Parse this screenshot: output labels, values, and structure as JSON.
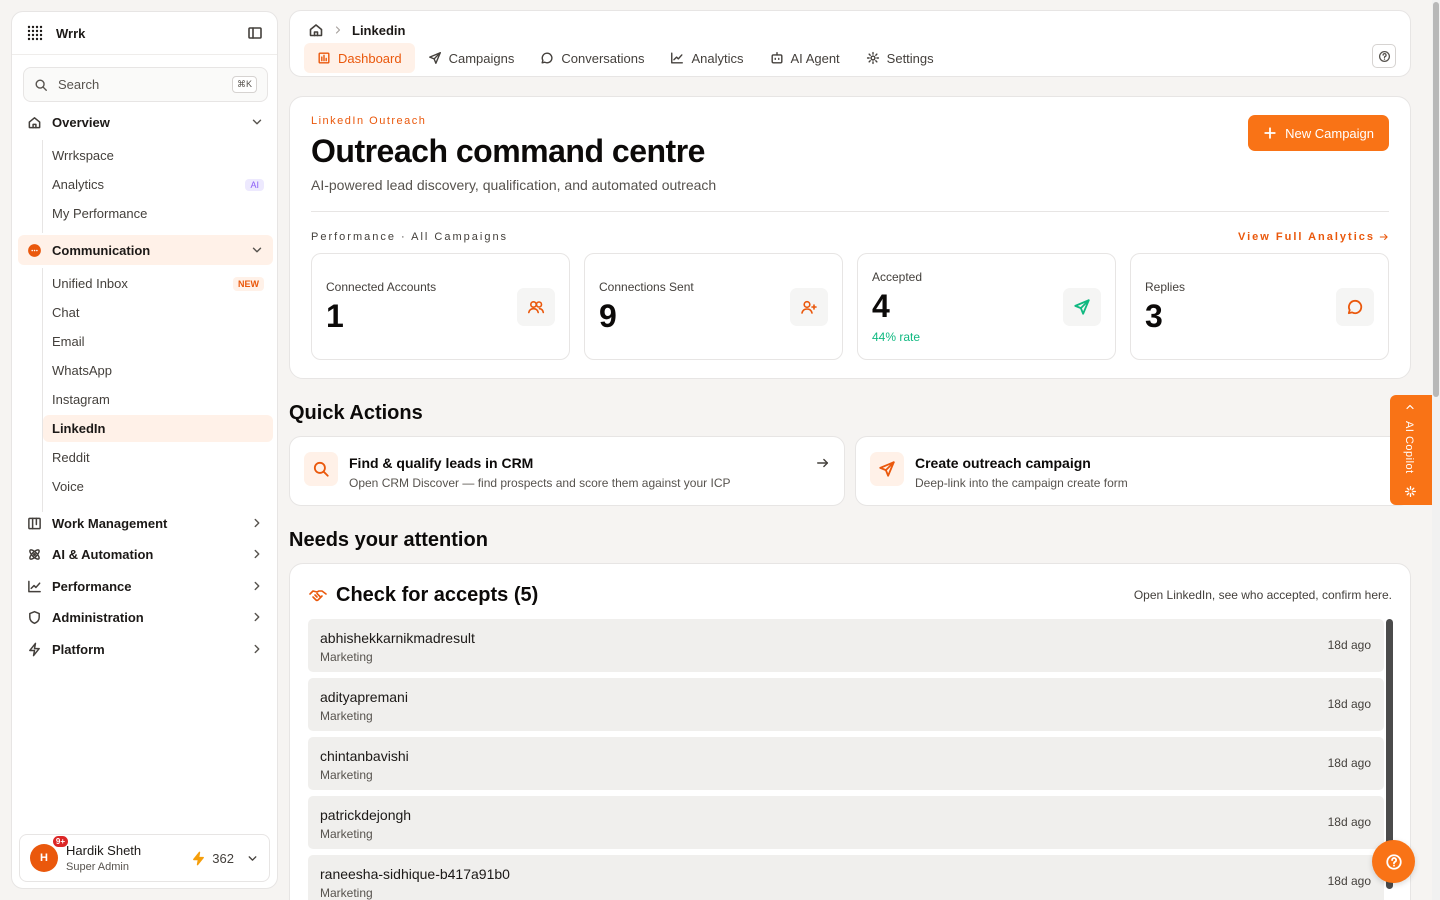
{
  "sidebar": {
    "brand": "Wrrk",
    "search_placeholder": "Search",
    "search_shortcut": "⌘K",
    "sections": {
      "overview": "Overview",
      "communication": "Communication",
      "work_management": "Work Management",
      "ai_automation": "AI & Automation",
      "performance": "Performance",
      "administration": "Administration",
      "platform": "Platform"
    },
    "overview_items": [
      "Wrrkspace",
      "Analytics",
      "My Performance"
    ],
    "analytics_tag": "AI",
    "communication_items": [
      "Unified Inbox",
      "Chat",
      "Email",
      "WhatsApp",
      "Instagram",
      "LinkedIn",
      "Reddit",
      "Voice"
    ],
    "unified_inbox_tag": "NEW",
    "active_item": "LinkedIn",
    "user": {
      "initial": "H",
      "badge": "9+",
      "name": "Hardik Sheth",
      "role": "Super Admin",
      "credits": "362"
    }
  },
  "topbar": {
    "breadcrumb_current": "Linkedin",
    "tabs": [
      "Dashboard",
      "Campaigns",
      "Conversations",
      "Analytics",
      "AI Agent",
      "Settings"
    ],
    "active_tab": "Dashboard"
  },
  "hero": {
    "eyebrow": "LinkedIn Outreach",
    "title": "Outreach command centre",
    "subtitle": "AI-powered lead discovery, qualification, and automated outreach",
    "new_campaign_label": "New Campaign",
    "performance_label": "Performance · All Campaigns",
    "view_analytics_label": "View Full Analytics"
  },
  "stats": [
    {
      "label": "Connected Accounts",
      "value": "1",
      "icon": "users-icon"
    },
    {
      "label": "Connections Sent",
      "value": "9",
      "icon": "user-plus-icon"
    },
    {
      "label": "Accepted",
      "value": "4",
      "rate": "44% rate",
      "icon": "send-icon"
    },
    {
      "label": "Replies",
      "value": "3",
      "icon": "message-icon"
    }
  ],
  "quick_actions": {
    "title": "Quick Actions",
    "items": [
      {
        "title": "Find & qualify leads in CRM",
        "desc": "Open CRM Discover — find prospects and score them against your ICP"
      },
      {
        "title": "Create outreach campaign",
        "desc": "Deep-link into the campaign create form"
      }
    ]
  },
  "attention": {
    "section_title": "Needs your attention",
    "card_title": "Check for accepts (5)",
    "hint": "Open LinkedIn, see who accepted, confirm here.",
    "rows": [
      {
        "name": "abhishekkarnikmadresult",
        "group": "Marketing",
        "ago": "18d ago"
      },
      {
        "name": "adityapremani",
        "group": "Marketing",
        "ago": "18d ago"
      },
      {
        "name": "chintanbavishi",
        "group": "Marketing",
        "ago": "18d ago"
      },
      {
        "name": "patrickdejongh",
        "group": "Marketing",
        "ago": "18d ago"
      },
      {
        "name": "raneesha-sidhique-b417a91b0",
        "group": "Marketing",
        "ago": "18d ago"
      }
    ]
  },
  "copilot": {
    "label": "AI Copilot"
  },
  "colors": {
    "accent": "#f97316",
    "accent_dark": "#ea580c",
    "accent_soft": "#fff1e8",
    "success": "#10b981"
  }
}
